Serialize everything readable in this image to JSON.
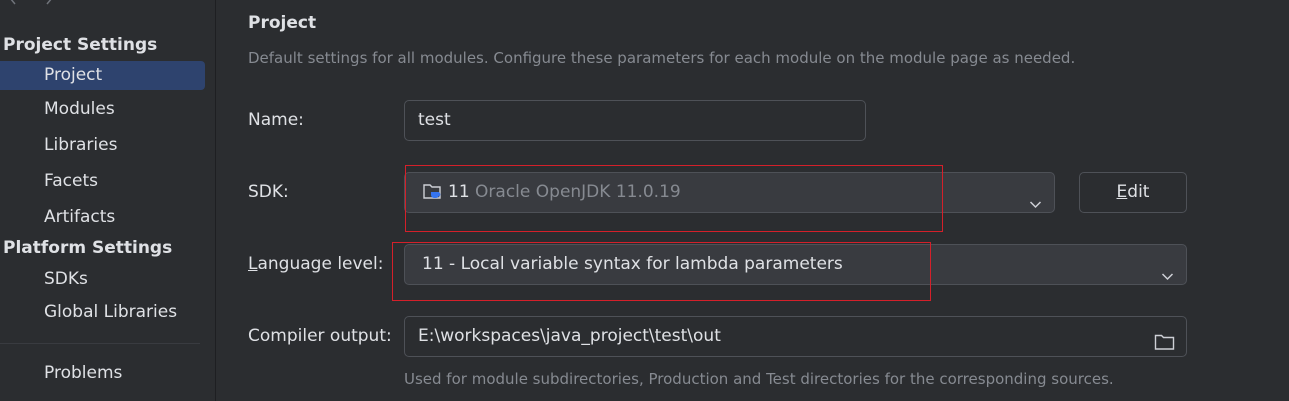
{
  "sidebar": {
    "project_settings_title": "Project Settings",
    "project_settings_items": [
      {
        "label": "Project",
        "selected": true
      },
      {
        "label": "Modules"
      },
      {
        "label": "Libraries"
      },
      {
        "label": "Facets"
      },
      {
        "label": "Artifacts"
      }
    ],
    "platform_settings_title": "Platform Settings",
    "platform_settings_items": [
      {
        "label": "SDKs"
      },
      {
        "label": "Global Libraries"
      }
    ],
    "problems_label": "Problems"
  },
  "main": {
    "title": "Project",
    "description": "Default settings for all modules. Configure these parameters for each module on the module page as needed.",
    "name": {
      "label": "Name:",
      "value": "test"
    },
    "sdk": {
      "label": "SDK:",
      "value_version": "11",
      "value_detail": "Oracle OpenJDK 11.0.19",
      "edit_button_mnemonic": "E",
      "edit_button_rest": "dit"
    },
    "language_level": {
      "label_mnemonic": "L",
      "label_rest": "anguage level:",
      "value": "11 - Local variable syntax for lambda parameters"
    },
    "compiler_output": {
      "label": "Compiler output:",
      "value": "E:\\workspaces\\java_project\\test\\out",
      "hint": "Used for module subdirectories, Production and Test directories for the corresponding sources."
    }
  },
  "icons": {
    "back": "chevron-left-icon",
    "forward": "chevron-right-icon",
    "dropdown": "chevron-down-icon",
    "sdk": "java-folder-icon",
    "browse": "folder-icon"
  },
  "colors": {
    "background": "#2b2d30",
    "selection": "#2e436e",
    "combo_background": "#393b40",
    "border": "#4e5157",
    "muted_text": "#868a91",
    "java_icon": "#3574f0",
    "highlight_box": "#d4202a"
  }
}
